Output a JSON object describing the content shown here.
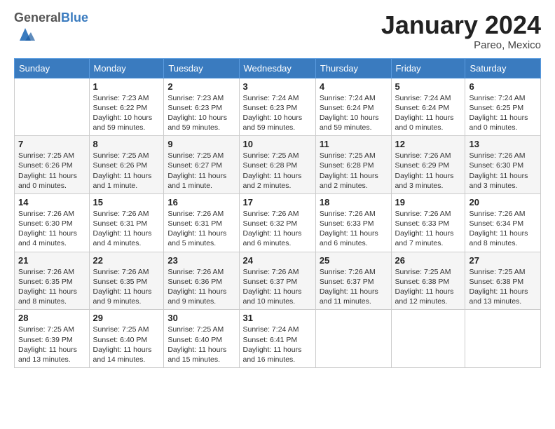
{
  "header": {
    "logo_general": "General",
    "logo_blue": "Blue",
    "month_year": "January 2024",
    "location": "Pareo, Mexico"
  },
  "weekdays": [
    "Sunday",
    "Monday",
    "Tuesday",
    "Wednesday",
    "Thursday",
    "Friday",
    "Saturday"
  ],
  "weeks": [
    [
      {
        "day": "",
        "info": ""
      },
      {
        "day": "1",
        "info": "Sunrise: 7:23 AM\nSunset: 6:22 PM\nDaylight: 10 hours\nand 59 minutes."
      },
      {
        "day": "2",
        "info": "Sunrise: 7:23 AM\nSunset: 6:23 PM\nDaylight: 10 hours\nand 59 minutes."
      },
      {
        "day": "3",
        "info": "Sunrise: 7:24 AM\nSunset: 6:23 PM\nDaylight: 10 hours\nand 59 minutes."
      },
      {
        "day": "4",
        "info": "Sunrise: 7:24 AM\nSunset: 6:24 PM\nDaylight: 10 hours\nand 59 minutes."
      },
      {
        "day": "5",
        "info": "Sunrise: 7:24 AM\nSunset: 6:24 PM\nDaylight: 11 hours\nand 0 minutes."
      },
      {
        "day": "6",
        "info": "Sunrise: 7:24 AM\nSunset: 6:25 PM\nDaylight: 11 hours\nand 0 minutes."
      }
    ],
    [
      {
        "day": "7",
        "info": "Sunrise: 7:25 AM\nSunset: 6:26 PM\nDaylight: 11 hours\nand 0 minutes."
      },
      {
        "day": "8",
        "info": "Sunrise: 7:25 AM\nSunset: 6:26 PM\nDaylight: 11 hours\nand 1 minute."
      },
      {
        "day": "9",
        "info": "Sunrise: 7:25 AM\nSunset: 6:27 PM\nDaylight: 11 hours\nand 1 minute."
      },
      {
        "day": "10",
        "info": "Sunrise: 7:25 AM\nSunset: 6:28 PM\nDaylight: 11 hours\nand 2 minutes."
      },
      {
        "day": "11",
        "info": "Sunrise: 7:25 AM\nSunset: 6:28 PM\nDaylight: 11 hours\nand 2 minutes."
      },
      {
        "day": "12",
        "info": "Sunrise: 7:26 AM\nSunset: 6:29 PM\nDaylight: 11 hours\nand 3 minutes."
      },
      {
        "day": "13",
        "info": "Sunrise: 7:26 AM\nSunset: 6:30 PM\nDaylight: 11 hours\nand 3 minutes."
      }
    ],
    [
      {
        "day": "14",
        "info": "Sunrise: 7:26 AM\nSunset: 6:30 PM\nDaylight: 11 hours\nand 4 minutes."
      },
      {
        "day": "15",
        "info": "Sunrise: 7:26 AM\nSunset: 6:31 PM\nDaylight: 11 hours\nand 4 minutes."
      },
      {
        "day": "16",
        "info": "Sunrise: 7:26 AM\nSunset: 6:31 PM\nDaylight: 11 hours\nand 5 minutes."
      },
      {
        "day": "17",
        "info": "Sunrise: 7:26 AM\nSunset: 6:32 PM\nDaylight: 11 hours\nand 6 minutes."
      },
      {
        "day": "18",
        "info": "Sunrise: 7:26 AM\nSunset: 6:33 PM\nDaylight: 11 hours\nand 6 minutes."
      },
      {
        "day": "19",
        "info": "Sunrise: 7:26 AM\nSunset: 6:33 PM\nDaylight: 11 hours\nand 7 minutes."
      },
      {
        "day": "20",
        "info": "Sunrise: 7:26 AM\nSunset: 6:34 PM\nDaylight: 11 hours\nand 8 minutes."
      }
    ],
    [
      {
        "day": "21",
        "info": "Sunrise: 7:26 AM\nSunset: 6:35 PM\nDaylight: 11 hours\nand 8 minutes."
      },
      {
        "day": "22",
        "info": "Sunrise: 7:26 AM\nSunset: 6:35 PM\nDaylight: 11 hours\nand 9 minutes."
      },
      {
        "day": "23",
        "info": "Sunrise: 7:26 AM\nSunset: 6:36 PM\nDaylight: 11 hours\nand 9 minutes."
      },
      {
        "day": "24",
        "info": "Sunrise: 7:26 AM\nSunset: 6:37 PM\nDaylight: 11 hours\nand 10 minutes."
      },
      {
        "day": "25",
        "info": "Sunrise: 7:26 AM\nSunset: 6:37 PM\nDaylight: 11 hours\nand 11 minutes."
      },
      {
        "day": "26",
        "info": "Sunrise: 7:25 AM\nSunset: 6:38 PM\nDaylight: 11 hours\nand 12 minutes."
      },
      {
        "day": "27",
        "info": "Sunrise: 7:25 AM\nSunset: 6:38 PM\nDaylight: 11 hours\nand 13 minutes."
      }
    ],
    [
      {
        "day": "28",
        "info": "Sunrise: 7:25 AM\nSunset: 6:39 PM\nDaylight: 11 hours\nand 13 minutes."
      },
      {
        "day": "29",
        "info": "Sunrise: 7:25 AM\nSunset: 6:40 PM\nDaylight: 11 hours\nand 14 minutes."
      },
      {
        "day": "30",
        "info": "Sunrise: 7:25 AM\nSunset: 6:40 PM\nDaylight: 11 hours\nand 15 minutes."
      },
      {
        "day": "31",
        "info": "Sunrise: 7:24 AM\nSunset: 6:41 PM\nDaylight: 11 hours\nand 16 minutes."
      },
      {
        "day": "",
        "info": ""
      },
      {
        "day": "",
        "info": ""
      },
      {
        "day": "",
        "info": ""
      }
    ]
  ]
}
